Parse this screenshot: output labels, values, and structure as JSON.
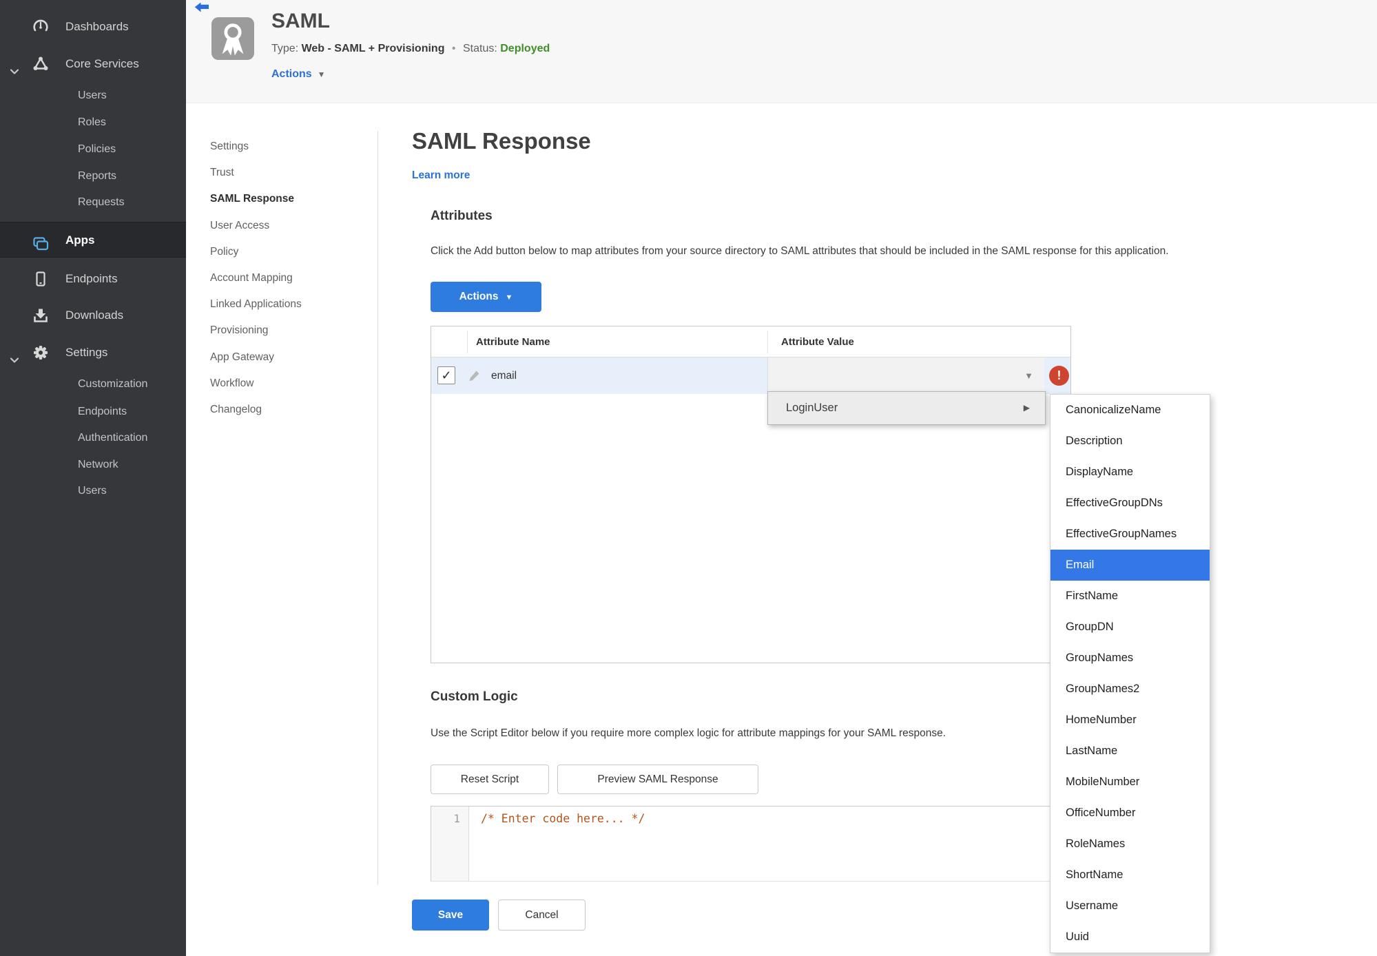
{
  "sidebar": {
    "items": [
      {
        "label": "Dashboards",
        "icon": "dashboard-icon"
      },
      {
        "label": "Core Services",
        "icon": "core-services-icon",
        "expanded": true,
        "children": [
          "Users",
          "Roles",
          "Policies",
          "Reports",
          "Requests"
        ]
      },
      {
        "label": "Apps",
        "icon": "apps-icon",
        "active": true
      },
      {
        "label": "Endpoints",
        "icon": "endpoint-icon"
      },
      {
        "label": "Downloads",
        "icon": "download-icon"
      },
      {
        "label": "Settings",
        "icon": "gear-icon",
        "expanded": true,
        "children": [
          "Customization",
          "Endpoints",
          "Authentication",
          "Network",
          "Users"
        ]
      }
    ]
  },
  "header": {
    "title": "SAML",
    "type_label": "Type:",
    "type_value": "Web - SAML + Provisioning",
    "dot": "•",
    "status_label": "Status:",
    "status_value": "Deployed",
    "actions_label": "Actions"
  },
  "subnav": {
    "active": "SAML Response",
    "items": [
      "Settings",
      "Trust",
      "SAML Response",
      "User Access",
      "Policy",
      "Account Mapping",
      "Linked Applications",
      "Provisioning",
      "App Gateway",
      "Workflow",
      "Changelog"
    ]
  },
  "main": {
    "title": "SAML Response",
    "learn_more": "Learn more"
  },
  "attributes": {
    "heading": "Attributes",
    "description": "Click the Add button below to map attributes from your source directory to SAML attributes that should be included in the SAML response for this application.",
    "actions_button": "Actions",
    "table": {
      "columns": [
        "Attribute Name",
        "Attribute Value"
      ],
      "row": {
        "name": "email",
        "value": "",
        "checked": true,
        "error": true
      }
    }
  },
  "dropdown": {
    "label": "LoginUser",
    "selected": "Email",
    "submenu": [
      "CanonicalizeName",
      "Description",
      "DisplayName",
      "EffectiveGroupDNs",
      "EffectiveGroupNames",
      "Email",
      "FirstName",
      "GroupDN",
      "GroupNames",
      "GroupNames2",
      "HomeNumber",
      "LastName",
      "MobileNumber",
      "OfficeNumber",
      "RoleNames",
      "ShortName",
      "Username",
      "Uuid"
    ]
  },
  "custom_logic": {
    "heading": "Custom Logic",
    "description": "Use the Script Editor below if you require more complex logic for attribute mappings for your SAML response.",
    "reset_button": "Reset Script",
    "preview_button": "Preview SAML Response"
  },
  "editor": {
    "line_number": "1",
    "code": "/* Enter code here... */"
  },
  "footer": {
    "save": "Save",
    "cancel": "Cancel"
  },
  "colors": {
    "accent_blue": "#2e7ce0",
    "link_blue": "#2a72d8",
    "status_green": "#3f8f28",
    "error_red": "#ce452f",
    "menu_selected_blue": "#3478e8",
    "row_highlight": "#e7f0fa",
    "code_comment_orange": "#b3541c",
    "sidebar_bg": "#35373a",
    "apps_icon_blue": "#55aee8"
  }
}
